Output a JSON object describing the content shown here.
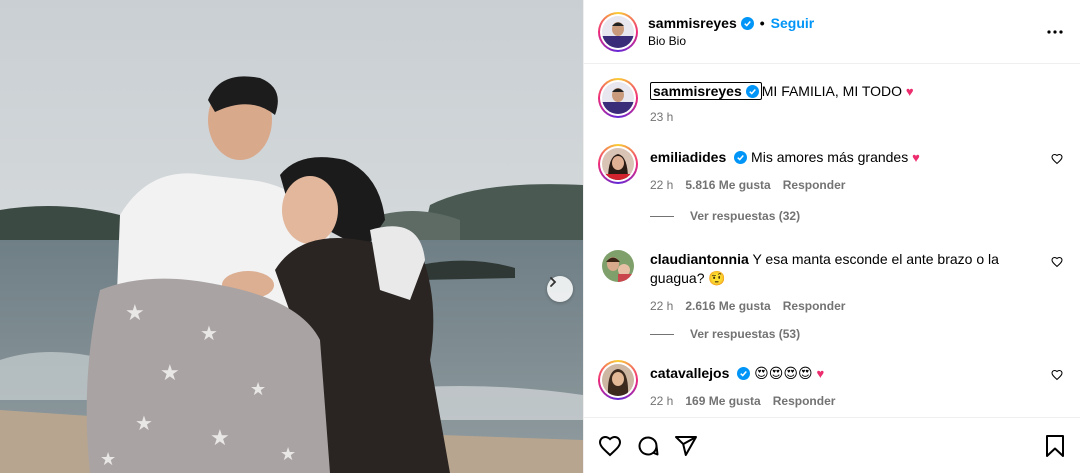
{
  "post": {
    "author": "sammisreyes",
    "follow_label": "Seguir",
    "dot": "•",
    "location": "Bio Bio",
    "caption": "MI FAMILIA, MI TODO",
    "caption_time": "23 h"
  },
  "comments": [
    {
      "user": "emiliadides",
      "verified": true,
      "text": "Mis amores más grandes",
      "time": "22 h",
      "likes": "5.816 Me gusta",
      "reply": "Responder",
      "view_replies": "Ver respuestas (32)"
    },
    {
      "user": "claudiantonnia",
      "verified": false,
      "text": "Y esa manta esconde el ante brazo o la guagua? 🤨",
      "time": "22 h",
      "likes": "2.616 Me gusta",
      "reply": "Responder",
      "view_replies": "Ver respuestas (53)"
    },
    {
      "user": "catavallejos",
      "verified": true,
      "text": "😍😍😍😍",
      "time": "22 h",
      "likes": "169 Me gusta",
      "reply": "Responder"
    }
  ],
  "icons": [
    "verified-badge-icon",
    "more-options-icon",
    "heart-icon",
    "comment-icon",
    "share-icon",
    "bookmark-icon",
    "next-photo-icon"
  ],
  "colors": {
    "accent": "#0095f6",
    "verified": "#0095f6",
    "heart": "#ed2d6d",
    "muted": "#737373"
  }
}
